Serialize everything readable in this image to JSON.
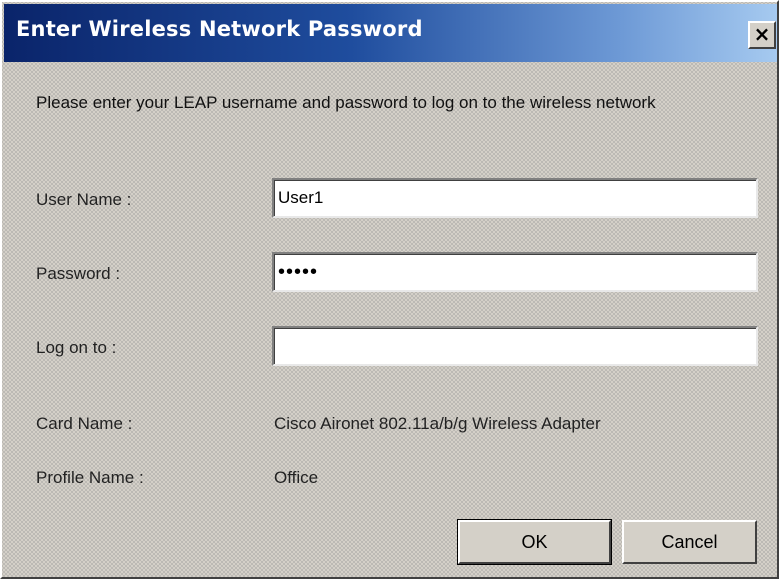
{
  "window": {
    "title": "Enter Wireless Network Password",
    "close_label": "×"
  },
  "intro_text": "Please enter your LEAP username and password to log on to the wireless network",
  "fields": {
    "username": {
      "label": "User Name :",
      "value": "User1"
    },
    "password": {
      "label": "Password :",
      "value": "•••••"
    },
    "logon": {
      "label": "Log on to :",
      "value": ""
    }
  },
  "info": {
    "card_name": {
      "label": "Card Name :",
      "value": "Cisco Aironet 802.11a/b/g Wireless Adapter"
    },
    "profile_name": {
      "label": "Profile Name :",
      "value": "Office"
    }
  },
  "buttons": {
    "ok": "OK",
    "cancel": "Cancel"
  }
}
